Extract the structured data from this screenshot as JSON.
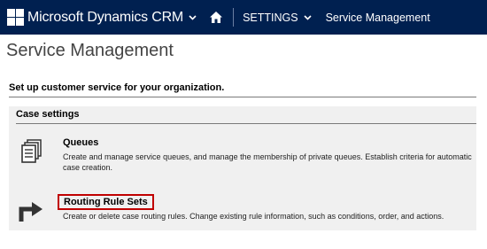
{
  "navbar": {
    "app_title": "Microsoft Dynamics CRM",
    "settings_label": "SETTINGS",
    "breadcrumb_current": "Service Management",
    "colors": {
      "background": "#002050",
      "text": "#ffffff"
    },
    "icons": [
      "ms-logo-icon",
      "chevron-down-icon",
      "home-icon"
    ]
  },
  "page": {
    "title": "Service Management",
    "section_heading": "Set up customer service for your organization."
  },
  "case_settings": {
    "heading": "Case settings",
    "items": [
      {
        "title": "Queues",
        "description": "Create and manage service queues, and manage the membership of private queues. Establish criteria for automatic case creation.",
        "icon": "queues-icon"
      },
      {
        "title": "Routing Rule Sets",
        "description": "Create or delete case routing rules. Change existing rule information, such as conditions, order, and actions.",
        "icon": "routing-arrow-icon",
        "highlight_color": "#c00000"
      }
    ]
  }
}
